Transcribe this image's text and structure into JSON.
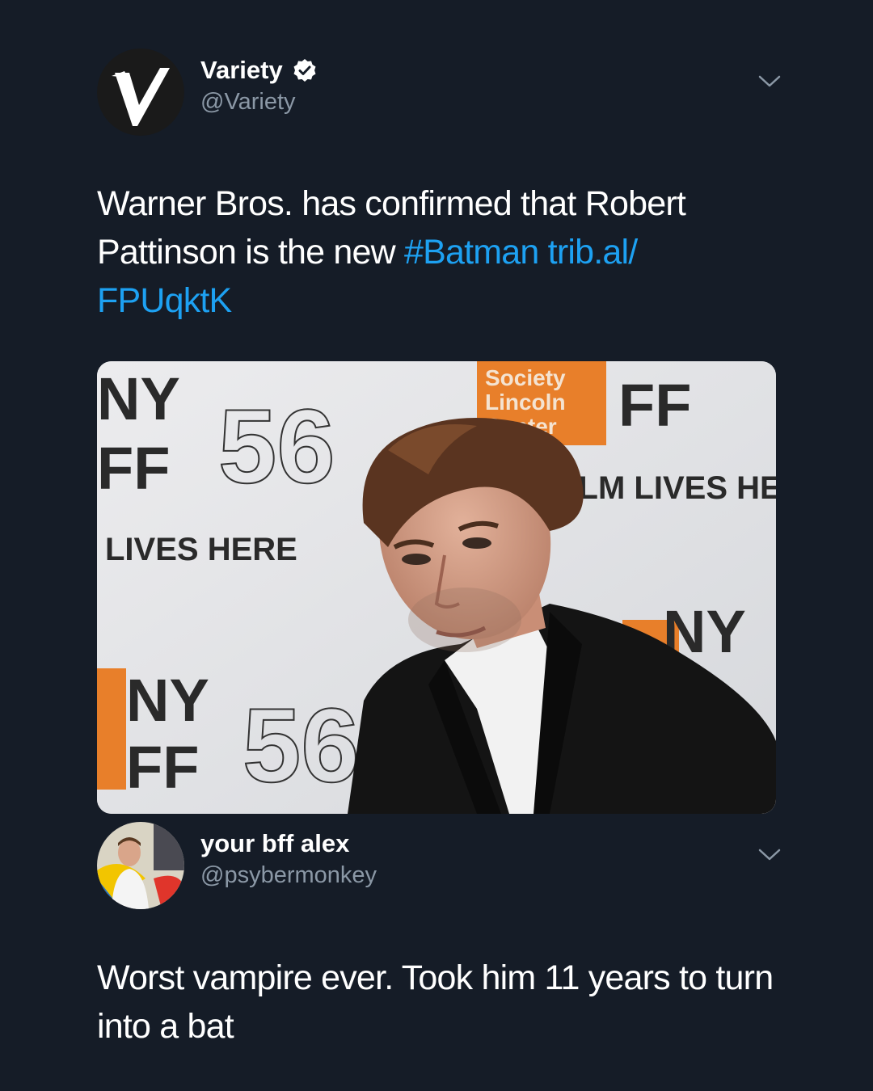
{
  "tweet1": {
    "display_name": "Variety",
    "handle": "@Variety",
    "text_pre": "Warner Bros. has confirmed that Robert Pattinson is the new ",
    "hashtag": "#Batman",
    "link": "trib.al/ FPUqktK",
    "verified_icon": "verified-badge-icon",
    "more_icon": "chevron-down-icon",
    "media": {
      "backdrop_texts": [
        "NY",
        "FF",
        "56",
        "LIVES HERE",
        "Society",
        "Lincoln",
        "Center",
        "FILM LIVES HE",
        "FF",
        "NY",
        "NY",
        "FF",
        "56"
      ]
    }
  },
  "tweet2": {
    "display_name": "your bff alex",
    "handle": "@psybermonkey",
    "text": "Worst vampire ever. Took him 11 years to turn into a bat",
    "more_icon": "chevron-down-icon"
  },
  "colors": {
    "background": "#151c27",
    "link": "#1da1f2",
    "handle": "#8b98a6",
    "text": "#ffffff"
  }
}
